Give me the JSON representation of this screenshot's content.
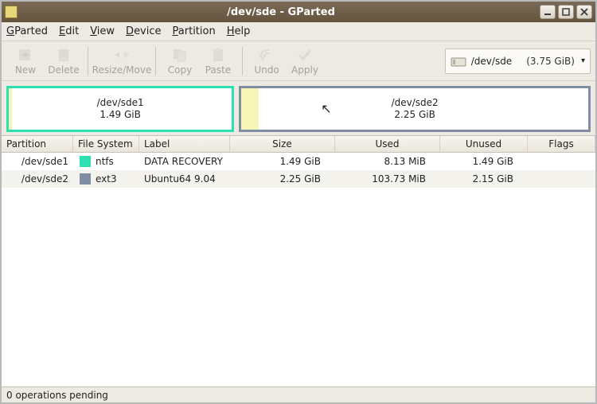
{
  "window": {
    "title": "/dev/sde - GParted"
  },
  "menubar": [
    {
      "label": "GParted",
      "uidx": 0
    },
    {
      "label": "Edit",
      "uidx": 0
    },
    {
      "label": "View",
      "uidx": 0
    },
    {
      "label": "Device",
      "uidx": 0
    },
    {
      "label": "Partition",
      "uidx": 0
    },
    {
      "label": "Help",
      "uidx": 0
    }
  ],
  "toolbar": {
    "new": "New",
    "delete": "Delete",
    "resize": "Resize/Move",
    "copy": "Copy",
    "paste": "Paste",
    "undo": "Undo",
    "apply": "Apply"
  },
  "device": {
    "path": "/dev/sde",
    "size": "(3.75 GiB)"
  },
  "graph": {
    "part1": {
      "name": "/dev/sde1",
      "size": "1.49 GiB"
    },
    "part2": {
      "name": "/dev/sde2",
      "size": "2.25 GiB"
    }
  },
  "columns": {
    "partition": "Partition",
    "filesystem": "File System",
    "label": "Label",
    "size": "Size",
    "used": "Used",
    "unused": "Unused",
    "flags": "Flags"
  },
  "rows": [
    {
      "partition": "/dev/sde1",
      "fs": "ntfs",
      "color": "#2edfb1",
      "label": "DATA RECOVERY",
      "size": "1.49 GiB",
      "used": "8.13 MiB",
      "unused": "1.49 GiB",
      "flags": ""
    },
    {
      "partition": "/dev/sde2",
      "fs": "ext3",
      "color": "#7f8ea3",
      "label": "Ubuntu64 9.04",
      "size": "2.25 GiB",
      "used": "103.73 MiB",
      "unused": "2.15 GiB",
      "flags": ""
    }
  ],
  "status": "0 operations pending"
}
